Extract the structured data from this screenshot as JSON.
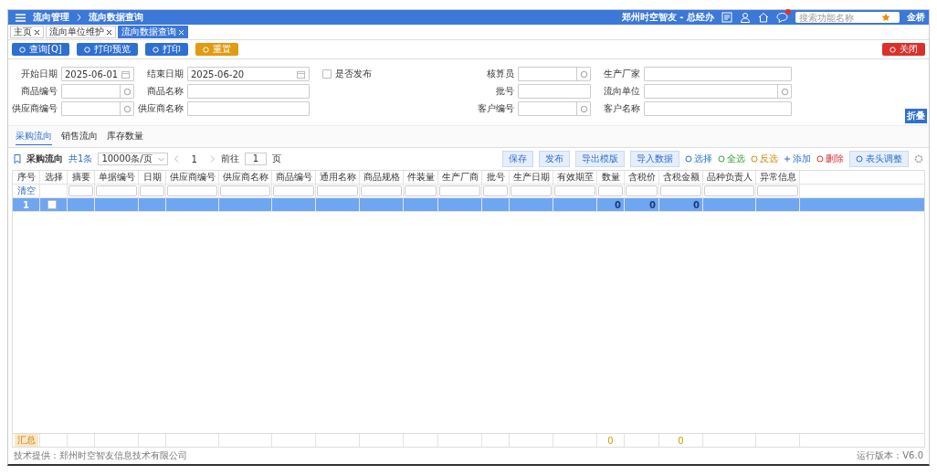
{
  "header": {
    "breadcrumb": [
      "流向管理",
      "流向数据查询"
    ],
    "org": "郑州时空智友 - 总经办",
    "search": {
      "placeholder": "搜索功能名称"
    },
    "user": "金桥",
    "notifications": true
  },
  "tabs": [
    {
      "label": "主页",
      "selected": false
    },
    {
      "label": "流向单位维护",
      "selected": false
    },
    {
      "label": "流向数据查询",
      "selected": true
    }
  ],
  "toolbar": [
    {
      "label": "查询[Q]",
      "kind": "primary"
    },
    {
      "label": "打印预览",
      "kind": "primary"
    },
    {
      "label": "打印",
      "kind": "primary"
    },
    {
      "label": "重置",
      "kind": "warning"
    },
    {
      "label": "关闭",
      "kind": "danger"
    }
  ],
  "filters": [
    {
      "label": "开始日期",
      "kind": "date",
      "value": "2025-06-01"
    },
    {
      "label": "结束日期",
      "kind": "date",
      "value": "2025-06-20"
    },
    {
      "label": "是否发布",
      "kind": "check",
      "checked": false
    },
    {
      "label": "核算员",
      "kind": "lookup"
    },
    {
      "label": "生产厂家",
      "kind": "text"
    },
    {
      "label": "商品编号",
      "kind": "lookup"
    },
    {
      "label": "商品名称",
      "kind": "text"
    },
    {
      "label": "批号",
      "kind": "text"
    },
    {
      "label": "流向单位",
      "kind": "lookup"
    },
    {
      "label": "供应商编号",
      "kind": "lookup"
    },
    {
      "label": "供应商名称",
      "kind": "text"
    },
    {
      "label": "客户编号",
      "kind": "lookup"
    },
    {
      "label": "客户名称",
      "kind": "text"
    }
  ],
  "collapse_button": "折叠",
  "section_tabs": [
    {
      "label": "采购流向",
      "selected": true
    },
    {
      "label": "销售流向",
      "selected": false
    },
    {
      "label": "库存数量",
      "selected": false
    }
  ],
  "grid_toolbar": {
    "title": "采购流向",
    "total": "共1条",
    "page_size": "10000条/页",
    "page": "1",
    "goto_label": "前往",
    "goto_value": "1",
    "page_unit": "页",
    "actions": [
      {
        "label": "保存",
        "kind": "button"
      },
      {
        "label": "发布",
        "kind": "button"
      },
      {
        "label": "导出模版",
        "kind": "button"
      },
      {
        "label": "导入数据",
        "kind": "button"
      },
      {
        "label": "选择",
        "kind": "select"
      },
      {
        "label": "全选",
        "kind": "all"
      },
      {
        "label": "反选",
        "kind": "invert"
      },
      {
        "label": "添加",
        "kind": "add"
      },
      {
        "label": "删除",
        "kind": "delete"
      },
      {
        "label": "表头调整",
        "kind": "adjust"
      }
    ]
  },
  "table": {
    "clear_label": "清空",
    "columns": [
      {
        "label": "序号",
        "filter": false,
        "values": [
          "1"
        ],
        "total": "汇总"
      },
      {
        "label": "选择",
        "filter": false
      },
      {
        "label": "摘要",
        "filter": true
      },
      {
        "label": "单据编号",
        "filter": true
      },
      {
        "label": "日期",
        "filter": true
      },
      {
        "label": "供应商编号",
        "filter": true
      },
      {
        "label": "供应商名称",
        "filter": true
      },
      {
        "label": "商品编号",
        "filter": true
      },
      {
        "label": "通用名称",
        "filter": true
      },
      {
        "label": "商品规格",
        "filter": true
      },
      {
        "label": "件装量",
        "filter": true
      },
      {
        "label": "生产厂商",
        "filter": true
      },
      {
        "label": "批号",
        "filter": true
      },
      {
        "label": "生产日期",
        "filter": true
      },
      {
        "label": "有效期至",
        "filter": true
      },
      {
        "label": "数量",
        "filter": true,
        "values": [
          "0"
        ],
        "total": "0"
      },
      {
        "label": "含税价",
        "filter": true,
        "values": [
          "0"
        ]
      },
      {
        "label": "含税金额",
        "filter": true,
        "values": [
          "0"
        ],
        "total": "0"
      },
      {
        "label": "品种负责人",
        "filter": true
      },
      {
        "label": "异常信息",
        "filter": true
      }
    ],
    "rows": [
      {
        "selected": true,
        "checked": false
      }
    ]
  },
  "footer": {
    "provider": "技术提供：郑州时空智友信息技术有限公司",
    "version": "运行版本：V6.0"
  }
}
